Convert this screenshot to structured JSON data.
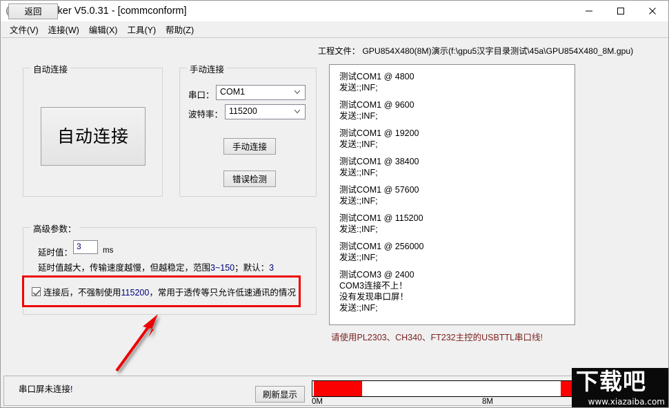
{
  "window": {
    "title": "GpuMaker V5.0.31 - [commconform]",
    "icon": "app-icon",
    "controls": {
      "minimize": "—",
      "maximize": "□",
      "close": "✕"
    }
  },
  "menubar": {
    "items": [
      {
        "label": "文件(V)"
      },
      {
        "label": "连接(W)"
      },
      {
        "label": "编辑(X)"
      },
      {
        "label": "工具(Y)"
      },
      {
        "label": "帮助(Z)"
      }
    ]
  },
  "toolbar": {
    "back_label": "返回",
    "project_file": "工程文件： GPU854X480(8M)演示(f:\\gpu5汉字目录测试\\45a\\GPU854X480_8M.gpu)"
  },
  "auto_group": {
    "title": "自动连接",
    "button_label": "自动连接"
  },
  "manual_group": {
    "title": "手动连接",
    "port_label": "串口：",
    "port_value": "COM1",
    "baud_label": "波特率：",
    "baud_value": "115200",
    "connect_label": "手动连接",
    "errcheck_label": "错误检测"
  },
  "advanced_group": {
    "title": "高级参数：",
    "delay_label": "延时值：",
    "delay_value": "3",
    "delay_unit": "ms",
    "hint_prefix": "延时值越大，传输速度越慢，但越稳定，范围",
    "hint_range": "3~150",
    "hint_mid": "；默认：",
    "hint_default": "3",
    "checkbox_prefix": "连接后，不强制使用",
    "checkbox_baud": "115200",
    "checkbox_suffix": "，常用于透传等只允许低速通讯的情况",
    "checkbox_checked": true,
    "highlight_color": "#ee0000"
  },
  "log": {
    "lines": [
      "测试COM1 @ 4800",
      "发送:;INF;",
      "",
      "测试COM1 @ 9600",
      "发送:;INF;",
      "",
      "测试COM1 @ 19200",
      "发送:;INF;",
      "",
      "测试COM1 @ 38400",
      "发送:;INF;",
      "",
      "测试COM1 @ 57600",
      "发送:;INF;",
      "",
      "测试COM1 @ 115200",
      "发送:;INF;",
      "",
      "测试COM1 @ 256000",
      "发送:;INF;",
      "",
      "测试COM3 @ 2400",
      "COM3连接不上！",
      "没有发现串口屏！",
      "发送:;INF;"
    ],
    "note": "请使用PL2303、CH340、FT232主控的USBTTL串口线!"
  },
  "statusbar": {
    "status_text": "串口屏未连接",
    "status_mark": "!",
    "refresh_label": "刷新显示",
    "progress": {
      "color": "#fa0000",
      "segments": [
        {
          "start_pct": 0.5,
          "width_pct": 18.5
        },
        {
          "start_pct": 95.0,
          "width_pct": 5.0
        }
      ],
      "scale_min": "0M",
      "scale_max": "8M"
    }
  },
  "watermark": {
    "logo": "下载吧",
    "url": "www.xiazaiba.com"
  }
}
